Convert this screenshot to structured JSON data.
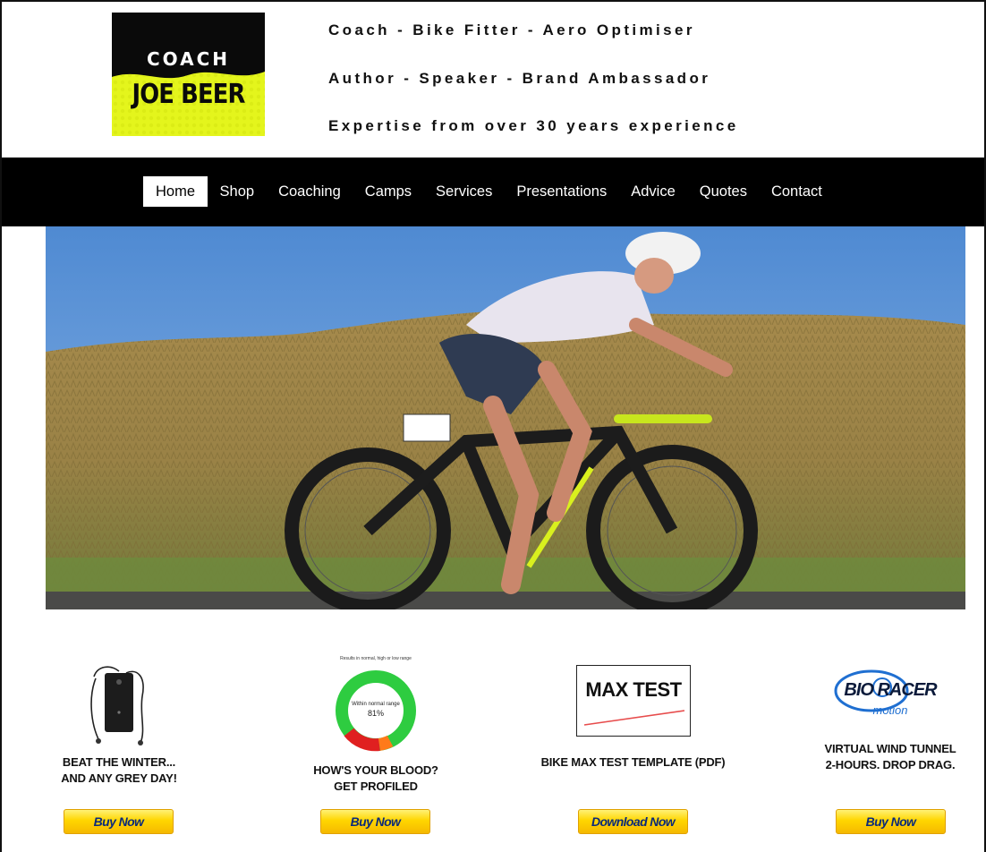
{
  "header": {
    "logo": {
      "line1": "COACH",
      "line2": "JOE BEER",
      "accent_color": "#e4f51c"
    },
    "taglines": [
      "Coach - Bike Fitter - Aero Optimiser",
      "Author - Speaker - Brand Ambassador",
      "Expertise from over 30 years experience"
    ]
  },
  "nav": {
    "items": [
      "Home",
      "Shop",
      "Coaching",
      "Camps",
      "Services",
      "Presentations",
      "Advice",
      "Quotes",
      "Contact"
    ],
    "active": "Home"
  },
  "products": [
    {
      "title_line1": "BEAT THE WINTER...",
      "title_line2": "AND ANY GREY DAY!",
      "button": "Buy Now",
      "icon": "light-therapy-device-icon"
    },
    {
      "title_line1": "HOW'S YOUR BLOOD?",
      "title_line2": "GET PROFILED",
      "button": "Buy Now",
      "icon": "blood-results-donut-icon",
      "chart_caption": "Results in normal, high or low range",
      "chart_label": "Within normal range",
      "chart_value": "81%"
    },
    {
      "title_line1": "BIKE MAX TEST TEMPLATE (PDF)",
      "button": "Download Now",
      "icon": "max-test-card-icon",
      "card_text": "MAX TEST"
    },
    {
      "title_line1": "VIRTUAL WIND TUNNEL",
      "title_line2": "2-HOURS. DROP DRAG.",
      "button": "Buy Now",
      "icon": "bio-racer-logo-icon",
      "logo_text": "BIO RACER",
      "logo_sub": "motion"
    }
  ],
  "colors": {
    "nav_bg": "#000000",
    "button": "#ffd600",
    "button_text": "#0b2a7a",
    "sky": "#5a93d6"
  }
}
